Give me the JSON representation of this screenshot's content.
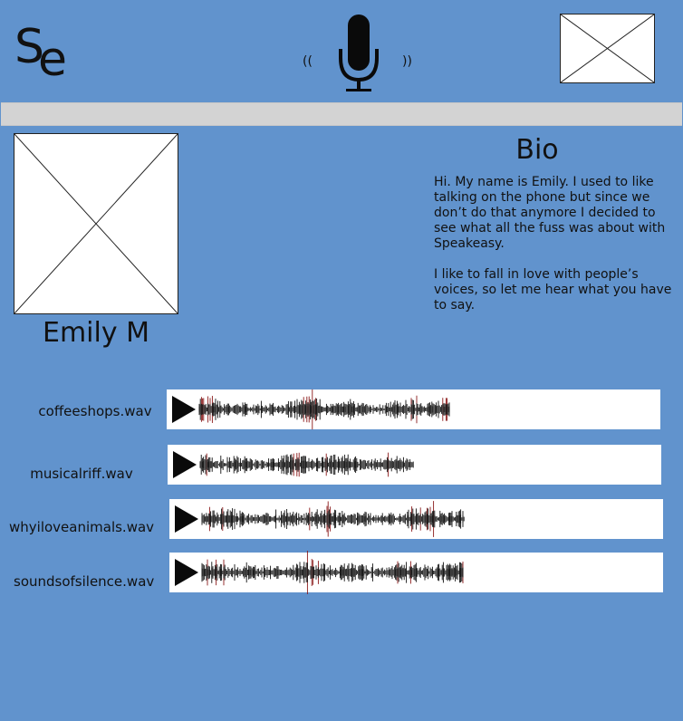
{
  "header": {
    "logo_text_s": "S",
    "logo_text_e": "e",
    "mic_icon": "microphone-with-sound-waves-icon",
    "wave_left": "((",
    "wave_right": "))"
  },
  "profile": {
    "name": "Emily M"
  },
  "bio": {
    "title": "Bio",
    "paragraphs": [
      "Hi. My name is Emily. I used to like talking on the phone but since we don’t do that anymore I decided to see what all the fuss was about with Speakeasy.",
      "I like to fall in love with people’s voices, so let me hear what you have to say."
    ]
  },
  "audio_clips": [
    {
      "filename": "coffeeshops.wav"
    },
    {
      "filename": "musicalriff.wav"
    },
    {
      "filename": "whyiloveanimals.wav"
    },
    {
      "filename": "soundsofsilence.wav"
    }
  ],
  "colors": {
    "background": "#6193cd",
    "nav_bar": "#d3d3d3",
    "waveform_core": "#111111",
    "waveform_accent": "#8b1a1a"
  }
}
